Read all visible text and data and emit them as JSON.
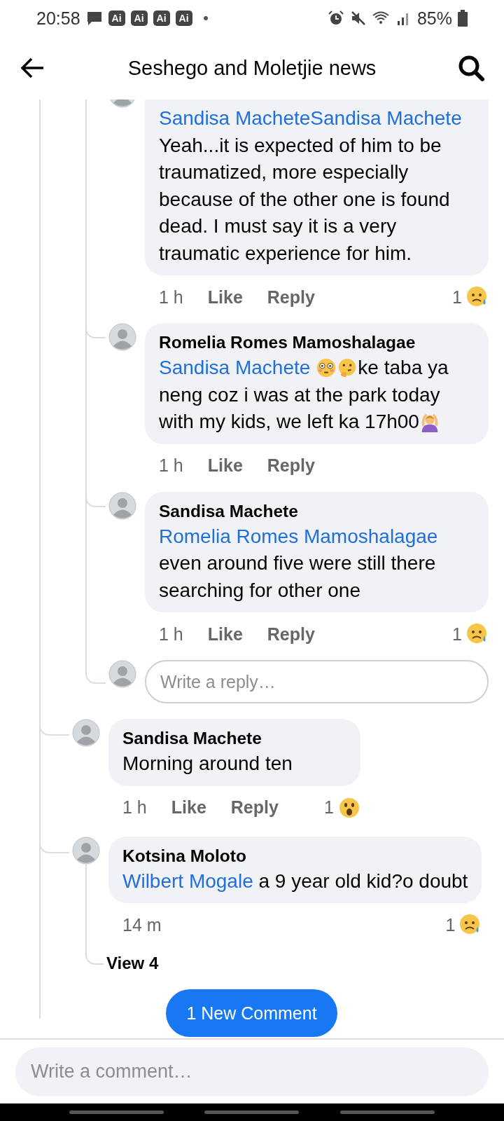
{
  "status_bar": {
    "time": "20:58",
    "badges": [
      "Ai",
      "Ai",
      "Ai",
      "Ai"
    ],
    "battery": "85%"
  },
  "header": {
    "title": "Seshego and Moletjie news"
  },
  "thread": {
    "replies": [
      {
        "body": [
          {
            "kind": "mention",
            "text": "Sandisa MacheteSandisa Machete"
          },
          {
            "kind": "text",
            "text": " Yeah...it is expected of him to be traumatized, more especially because of the other one is found dead. I must say it is a very traumatic experience for him."
          }
        ],
        "time": "1 h",
        "actions": [
          "Like",
          "Reply"
        ],
        "reaction": {
          "count": "1",
          "kind": "sad"
        }
      },
      {
        "author": "Romelia Romes Mamoshalagae",
        "body": [
          {
            "kind": "mention",
            "text": "Sandisa Machete"
          },
          {
            "kind": "flushed"
          },
          {
            "kind": "thinking"
          },
          {
            "kind": "text",
            "text": "ke taba ya neng coz i was at the park today with my kids, we left ka 17h00"
          },
          {
            "kind": "gesture"
          }
        ],
        "time": "1 h",
        "actions": [
          "Like",
          "Reply"
        ]
      },
      {
        "author": "Sandisa Machete",
        "body": [
          {
            "kind": "mention",
            "text": "Romelia Romes Mamoshalagae"
          },
          {
            "kind": "text",
            "text": " even around five were still there searching for other one"
          }
        ],
        "time": "1 h",
        "actions": [
          "Like",
          "Reply"
        ],
        "reaction": {
          "count": "1",
          "kind": "sad"
        }
      }
    ],
    "reply_field": {
      "placeholder": "Write a reply…"
    }
  },
  "comments": [
    {
      "author": "Sandisa Machete",
      "body": [
        {
          "kind": "text",
          "text": "Morning  around ten"
        }
      ],
      "time": "1 h",
      "actions": [
        "Like",
        "Reply"
      ],
      "reaction": {
        "count": "1",
        "kind": "wow"
      }
    },
    {
      "author": "Kotsina Moloto",
      "body": [
        {
          "kind": "mention",
          "text": "Wilbert Mogale"
        },
        {
          "kind": "text",
          "text": " a 9 year old kid?o doubt"
        }
      ],
      "time": "14 m",
      "reaction": {
        "count": "1",
        "kind": "sad"
      },
      "more_replies": "View 4"
    }
  ],
  "new_comment_button": "1 New Comment",
  "comment_field": {
    "placeholder": "Write a comment…"
  }
}
